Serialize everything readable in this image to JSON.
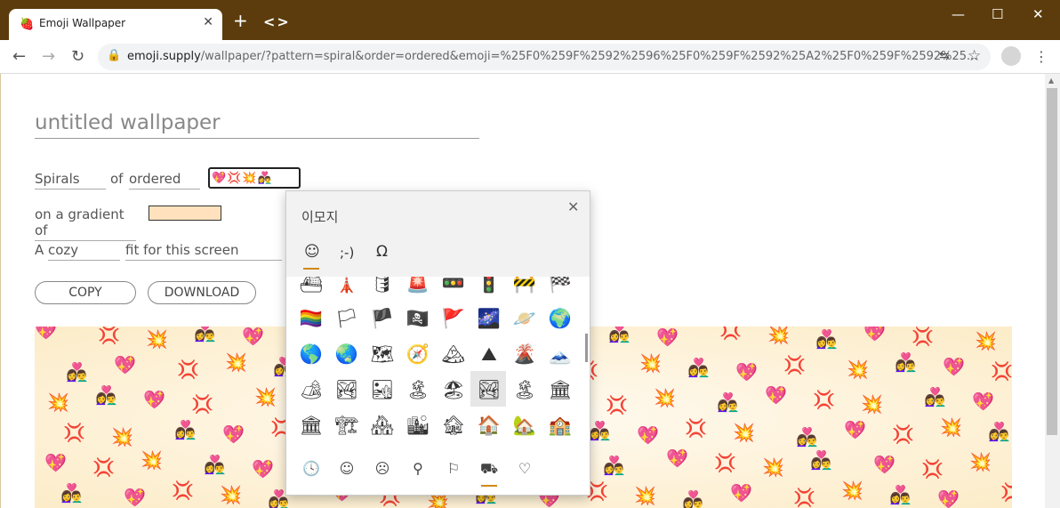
{
  "browser": {
    "tab_title": "Emoji Wallpaper",
    "tab_favicon": "🍓",
    "tab_close": "✕",
    "new_tab": "+",
    "tab_search": "<>",
    "url_host": "emoji.supply",
    "url_rest": "/wallpaper/?pattern=spiral&order=ordered&emoji=%25F0%259F%2592%2596%25F0%259F%2592%25A2%25F0%259F%2592%25...",
    "win_min": "—",
    "win_max": "☐",
    "win_close": "✕",
    "back": "←",
    "forward": "→",
    "reload": "↻",
    "lock": "🔒",
    "translate": "⇆",
    "star": "☆",
    "menu": "⋮"
  },
  "form": {
    "title_placeholder": "untitled wallpaper",
    "pattern": "Spirals",
    "of": "of",
    "order": "ordered",
    "emoji_value": "💖💢💥👩‍❤️‍👨",
    "gradient_label": "on a gradient of",
    "gradient_color": "#ffe2bd",
    "a_label": "A",
    "size": "cozy",
    "fit_label": "fit for this screen",
    "copy_button": "COPY",
    "download_button": "DOWNLOAD"
  },
  "picker": {
    "title": "이모지",
    "close": "✕",
    "tabs": [
      "☺",
      ";-)",
      "Ω"
    ],
    "grid": [
      [
        "⛴",
        "🗼",
        "🛢",
        "🚨",
        "🚥",
        "🚦",
        "🚧",
        "🏁"
      ],
      [
        "🏳️‍🌈",
        "🏳",
        "🏴",
        "🏴‍☠️",
        "🚩",
        "🌌",
        "🪐",
        "🌍"
      ],
      [
        "🌎",
        "🌏",
        "🗺",
        "🧭",
        "🏔",
        "⛰",
        "🌋",
        "🗻"
      ],
      [
        "🏕",
        "🏞",
        "🏜",
        "🏝",
        "🏖",
        "🏞",
        "🏝",
        "🏛"
      ],
      [
        "🏛",
        "🏗",
        "🏘",
        "🏙",
        "🏚",
        "🏠",
        "🏡",
        "🏫"
      ]
    ],
    "categories": [
      "🕓",
      "☺",
      "☹",
      "⚲",
      "⚐",
      "⛟",
      "♡"
    ]
  },
  "wallpaper": {
    "emojis": [
      "💖",
      "💢",
      "💥",
      "👩‍❤️‍👨"
    ]
  }
}
